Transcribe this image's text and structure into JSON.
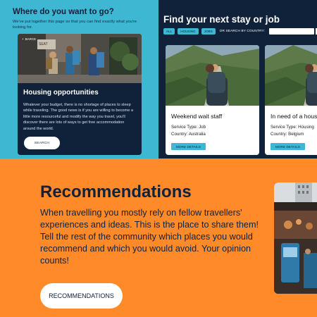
{
  "housing_section": {
    "title": "Where do you want to go?",
    "subtitle": "We've put together this page so that you can find exactly what you're looking for.",
    "card": {
      "back_label": "BARCE",
      "heading": "Housing opportunities",
      "text": "Whatever your budget, there is no shortage of places to sleep while traveling. The good news is if you are willing to become a little more resourceful and modify the way you travel, you'll discover there are lots of ways to get free accommodation around the world.",
      "button_label": "SEARCH"
    }
  },
  "jobs_section": {
    "title": "Find your next stay or job",
    "filters": [
      "ALL",
      "HOUSING",
      "JOBS"
    ],
    "country_label": "OR SEARCH BY COUNTRY:",
    "country_placeholder": "",
    "cards": [
      {
        "title": "Weekend wait staff",
        "service": "Service Type: Job",
        "country": "Country: Australia",
        "button_label": "MORE DETAILS"
      },
      {
        "title": "In need of a housesitter",
        "service": "Service Type: Housing",
        "country": "Country: Belgium",
        "button_label": "MORE DETAILS"
      }
    ]
  },
  "recommendations": {
    "title": "Recommendations",
    "text": "When travelling you mostly rely on fellow travellers' experiences and ideas. This is the place to share them! Tell the rest of the community which places you would recommend and which you would avoid. Your opinion counts!",
    "button_label": "RECOMMENDATIONS"
  },
  "colors": {
    "cyan": "#3db7d2",
    "navy": "#10213a",
    "orange": "#ff8a2a",
    "white": "#ffffff"
  }
}
